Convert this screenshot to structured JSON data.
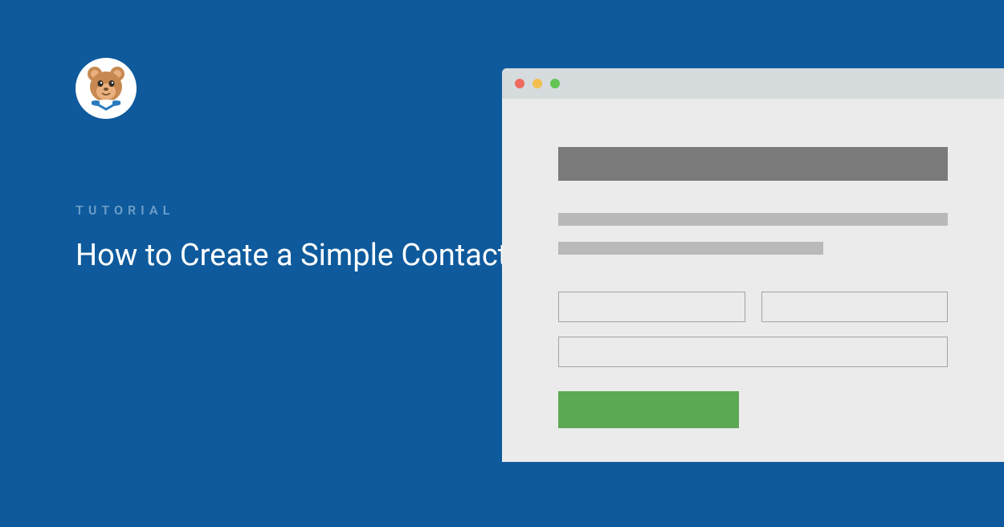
{
  "category": "TUTORIAL",
  "title": "How to Create a Simple Contact Form in WordPress",
  "logo": {
    "name": "wpforms-mascot",
    "colors": {
      "face": "#c78951",
      "earInner": "#e9b07d",
      "shirt": "#ffffff",
      "collar": "#2a7abf",
      "eyes": "#2d2a28"
    }
  },
  "window": {
    "trafficLights": {
      "red": "#ed6b5f",
      "yellow": "#f5bf50",
      "green": "#62c553"
    },
    "submitButtonColor": "#5da853"
  }
}
